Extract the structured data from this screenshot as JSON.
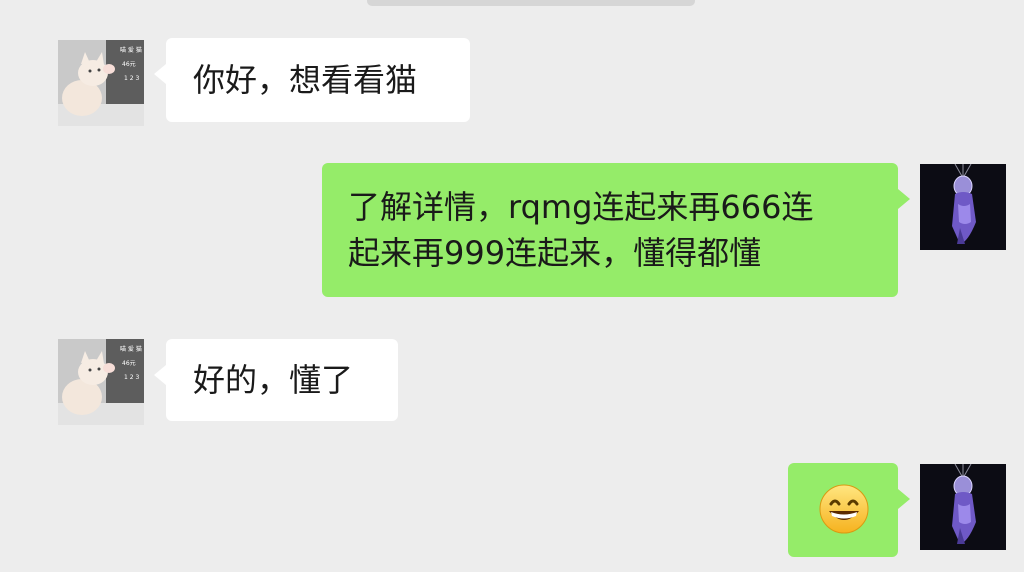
{
  "chat": {
    "messages": [
      {
        "sender": "contact",
        "text": "你好，想看看猫"
      },
      {
        "sender": "self",
        "line1": "了解详情，rqmg连起来再666连",
        "line2": "起来再999连起来，懂得都懂"
      },
      {
        "sender": "contact",
        "text": "好的，懂了"
      },
      {
        "sender": "self",
        "emoji": "grinning-face-emoji"
      }
    ]
  },
  "avatar_text": {
    "line1": "喵 爱 猫",
    "line2": "46元",
    "line3": "1 2 3"
  },
  "colors": {
    "background": "#ededed",
    "self_bubble": "#95ec69",
    "contact_bubble": "#ffffff"
  },
  "icons": {
    "contact_avatar": "cat-avatar-image",
    "self_avatar": "astronaut-avatar-image",
    "emoji": "grinning-face-emoji"
  }
}
